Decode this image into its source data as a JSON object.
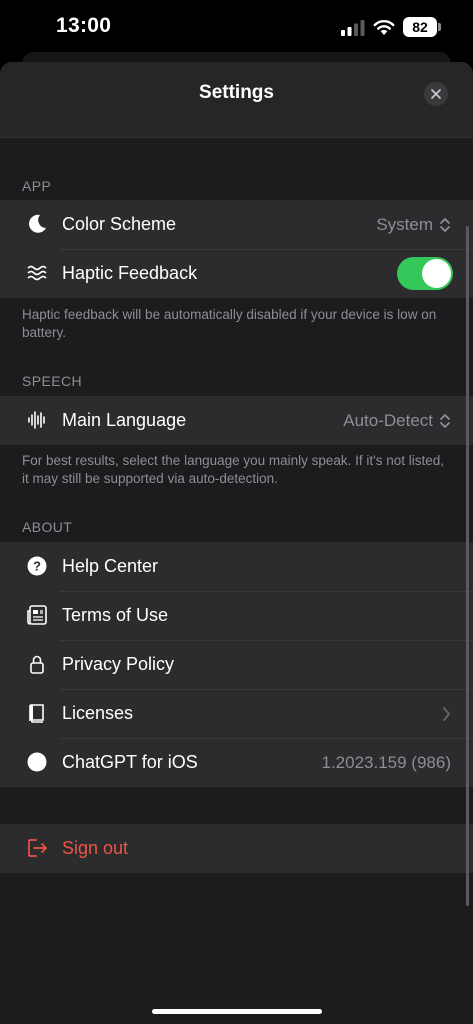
{
  "status_bar": {
    "time": "13:00",
    "battery": "82"
  },
  "header": {
    "title": "Settings"
  },
  "app_section": {
    "title": "APP",
    "color_scheme": {
      "label": "Color Scheme",
      "value": "System"
    },
    "haptic": {
      "label": "Haptic Feedback",
      "enabled": true
    },
    "note": "Haptic feedback will be automatically disabled if your device is low on battery."
  },
  "speech_section": {
    "title": "SPEECH",
    "main_language": {
      "label": "Main Language",
      "value": "Auto-Detect"
    },
    "note": "For best results, select the language you mainly speak. If it's not listed, it may still be supported via auto-detection."
  },
  "about_section": {
    "title": "ABOUT",
    "help_center": "Help Center",
    "terms": "Terms of Use",
    "privacy": "Privacy Policy",
    "licenses": "Licenses",
    "app_version": {
      "label": "ChatGPT for iOS",
      "value": "1.2023.159 (986)"
    }
  },
  "sign_out": {
    "label": "Sign out"
  },
  "colors": {
    "accent_green": "#34c759",
    "danger_red": "#eb5545",
    "background": "#1c1c1e",
    "cell": "#2c2c2e"
  },
  "icons": [
    "moon-icon",
    "haptic-waves-icon",
    "waveform-icon",
    "question-circle-icon",
    "newspaper-icon",
    "lock-icon",
    "book-icon",
    "circle-icon",
    "sign-out-icon",
    "close-icon",
    "chevron-updown-icon",
    "chevron-right-icon"
  ]
}
